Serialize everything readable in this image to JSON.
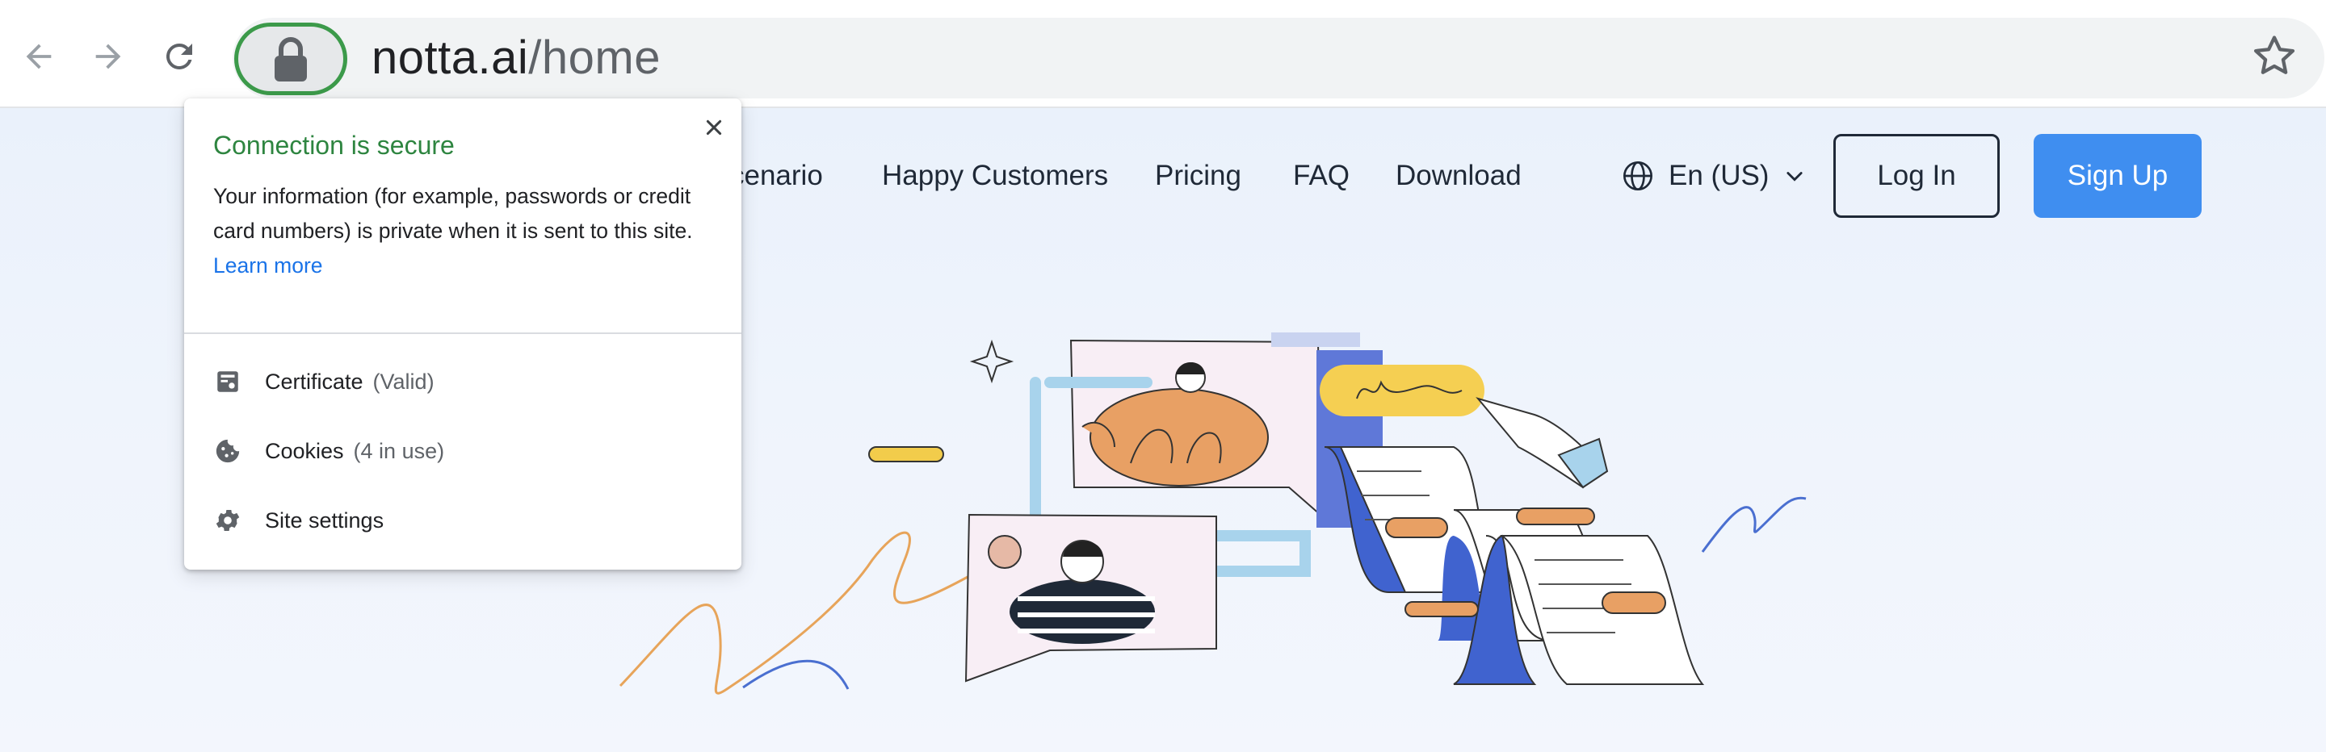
{
  "browser": {
    "url_domain": "notta.ai",
    "url_path": "/home",
    "back_icon": "arrow-left-icon",
    "forward_icon": "arrow-right-icon",
    "reload_icon": "reload-icon",
    "lock_icon": "lock-icon",
    "bookmark_icon": "star-icon"
  },
  "site": {
    "nav": [
      "cenario",
      "Happy Customers",
      "Pricing",
      "FAQ",
      "Download"
    ],
    "language": "En (US)",
    "login_label": "Log In",
    "signup_label": "Sign Up",
    "colors": {
      "signup_bg": "#3f8ef0",
      "background": "#eef3fb"
    }
  },
  "security_popup": {
    "title": "Connection is secure",
    "body": "Your information (for example, passwords or credit card numbers) is private when it is sent to this site.",
    "learn_more": "Learn more",
    "rows": [
      {
        "label": "Certificate",
        "detail": "(Valid)",
        "icon": "certificate-icon"
      },
      {
        "label": "Cookies",
        "detail": "(4 in use)",
        "icon": "cookie-icon"
      },
      {
        "label": "Site settings",
        "detail": "",
        "icon": "gear-icon"
      }
    ],
    "title_color": "#2e8540",
    "link_color": "#1a73e8"
  }
}
